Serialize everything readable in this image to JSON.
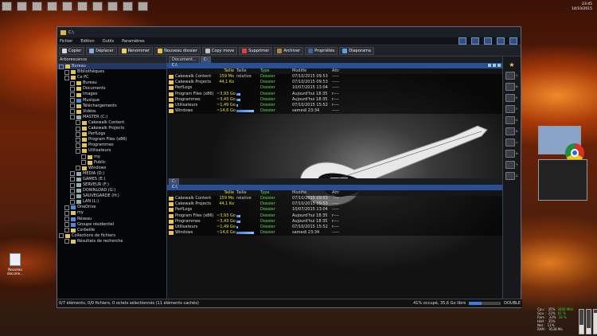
{
  "clock": {
    "time": "23:45",
    "date": "14/10/2015"
  },
  "window": {
    "title": "C:\\"
  },
  "menu": [
    "Fichier",
    "Edition",
    "Outils",
    "Paramètres"
  ],
  "toolbar": [
    {
      "label": "Copier",
      "color": "#d8d8d8"
    },
    {
      "label": "Déplacer",
      "color": "#7fb0e0"
    },
    {
      "label": "Renommer",
      "color": "#f0d060"
    },
    {
      "label": "Nouveau dossier",
      "color": "#f0c040"
    },
    {
      "label": "Copy move",
      "color": "#c0c0c0"
    },
    {
      "label": "Supprimer",
      "color": "#e04040"
    },
    {
      "label": "Archiver",
      "color": "#b08040"
    },
    {
      "label": "Propriétés",
      "color": "#4060a0"
    },
    {
      "label": "Diaporama",
      "color": "#60a0e0"
    }
  ],
  "tree": {
    "header": "Arborescence",
    "items": [
      {
        "label": "Bureau",
        "indent": 0,
        "icon": "desktop-icon"
      },
      {
        "label": "Bibliothèques",
        "indent": 1,
        "icon": "library-icon"
      },
      {
        "label": "Ce PC",
        "indent": 1,
        "icon": "computer-icon"
      },
      {
        "label": "Bureau",
        "indent": 2,
        "icon": "folder-icon"
      },
      {
        "label": "Documents",
        "indent": 2,
        "icon": "folder-icon"
      },
      {
        "label": "Images",
        "indent": 2,
        "icon": "folder-icon"
      },
      {
        "label": "Musique",
        "indent": 2,
        "icon": "music-icon"
      },
      {
        "label": "Téléchargements",
        "indent": 2,
        "icon": "download-icon"
      },
      {
        "label": "Vidéos",
        "indent": 2,
        "icon": "folder-icon"
      },
      {
        "label": "MASTER (C:)",
        "indent": 2,
        "icon": "drive-icon"
      },
      {
        "label": "Cakewalk Content",
        "indent": 3,
        "icon": "folder-icon"
      },
      {
        "label": "Cakewalk Projects",
        "indent": 3,
        "icon": "folder-icon"
      },
      {
        "label": "PerfLogs",
        "indent": 3,
        "icon": "folder-icon"
      },
      {
        "label": "Program Files (x86)",
        "indent": 3,
        "icon": "folder-icon"
      },
      {
        "label": "Programmes",
        "indent": 3,
        "icon": "folder-icon"
      },
      {
        "label": "Utilisateurs",
        "indent": 3,
        "icon": "folder-icon"
      },
      {
        "label": "my",
        "indent": 4,
        "icon": "folder-icon"
      },
      {
        "label": "Public",
        "indent": 4,
        "icon": "folder-icon"
      },
      {
        "label": "Windows",
        "indent": 3,
        "icon": "folder-icon"
      },
      {
        "label": "MEDIA (D:)",
        "indent": 2,
        "icon": "drive-icon"
      },
      {
        "label": "GAMES (E:)",
        "indent": 2,
        "icon": "drive-icon"
      },
      {
        "label": "SERVEUR (F:)",
        "indent": 2,
        "icon": "drive-icon"
      },
      {
        "label": "DOWNLOAD (G:)",
        "indent": 2,
        "icon": "drive-icon"
      },
      {
        "label": "SAUVEGARDE (H:)",
        "indent": 2,
        "icon": "drive-icon"
      },
      {
        "label": "LAN (L:)",
        "indent": 2,
        "icon": "drive-icon"
      },
      {
        "label": "OneDrive",
        "indent": 1,
        "icon": "cloud-icon"
      },
      {
        "label": "my",
        "indent": 1,
        "icon": "user-icon"
      },
      {
        "label": "Réseau",
        "indent": 1,
        "icon": "network-icon"
      },
      {
        "label": "Groupe résidentiel",
        "indent": 1,
        "icon": "homegroup-icon"
      },
      {
        "label": "Corbeille",
        "indent": 1,
        "icon": "recycle-bin-icon"
      },
      {
        "label": "Collections de fichiers",
        "indent": 0,
        "icon": "collection-icon"
      },
      {
        "label": "Résultats de recherche",
        "indent": 1,
        "icon": "folder-icon"
      }
    ]
  },
  "tabs": [
    {
      "label": "Document..."
    },
    {
      "label": "C:"
    }
  ],
  "upper_path": "C:\\",
  "lower_tab": "C:",
  "lower_path": "C:\\",
  "columns": {
    "size": "Taille",
    "rel": "Taille relative",
    "type": "Type",
    "modified": "Modifié",
    "attr": "Attr"
  },
  "files": [
    {
      "name": "Cakewalk Content",
      "size": "159 Mo",
      "rel": 0.0,
      "type": "Dossier",
      "modified": "07/10/2015  09:53",
      "attr": "-----"
    },
    {
      "name": "Cakewalk Projects",
      "size": "44,1 Ko",
      "rel": 0.0,
      "type": "Dossier",
      "modified": "07/10/2015  09:53",
      "attr": "-----"
    },
    {
      "name": "PerfLogs",
      "size": "",
      "rel": 0.0,
      "type": "Dossier",
      "modified": "10/07/2015  13:04",
      "attr": "-----"
    },
    {
      "name": "Program Files (x86)",
      "size": "~3,93 Go",
      "rel": 0.2,
      "type": "Dossier",
      "modified": "Aujourd'hui  18:35",
      "attr": "r----"
    },
    {
      "name": "Programmes",
      "size": "~3,43 Go",
      "rel": 0.18,
      "type": "Dossier",
      "modified": "Aujourd'hui  18:35",
      "attr": "r----"
    },
    {
      "name": "Utilisateurs",
      "size": "~1,49 Go",
      "rel": 0.08,
      "type": "Dossier",
      "modified": "07/10/2015  15:52",
      "attr": "r----"
    },
    {
      "name": "Windows",
      "size": "~14,6 Go",
      "rel": 0.85,
      "type": "Dossier",
      "modified": "samedi  23:34",
      "attr": "-----"
    }
  ],
  "drives": [
    "C:",
    "D:",
    "E:",
    "F:",
    "G:",
    "H:",
    "L:",
    "X:",
    "Y:",
    "Z:"
  ],
  "status": {
    "left": "0/7 éléments, 0/0 fichiers, 0 octets sélectionnés (11 éléments cachés)",
    "free": "41% occupé, 35,6 Go libre",
    "free_fill": 0.41,
    "mode": "DOUBLE"
  },
  "desktop_icon": "Nouveau docume...",
  "sysmon": {
    "rows": [
      {
        "k": "Cpu :",
        "v": "35%",
        "h": "3600 MHz"
      },
      {
        "k": "Gpu :",
        "v": "22%",
        "h": "61 %"
      },
      {
        "k": "Ram :",
        "v": "33%",
        "h": "18 %"
      },
      {
        "k": "Hdd :",
        "v": "35%",
        "h": ""
      },
      {
        "k": "Net :",
        "v": "11%",
        "h": ""
      },
      {
        "k": "RAM :",
        "v": "9538 Mo",
        "h": ""
      }
    ],
    "bars": [
      0.35,
      0.22,
      0.85
    ]
  }
}
